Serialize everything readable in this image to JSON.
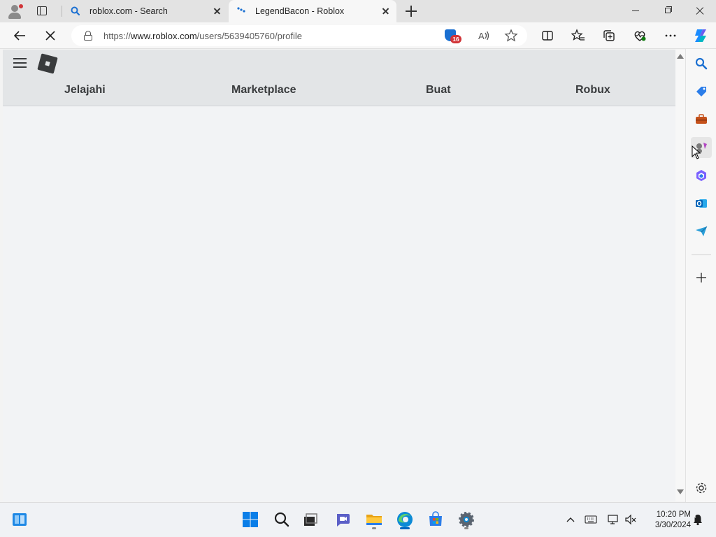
{
  "browser": {
    "tabs": [
      {
        "title": "roblox.com - Search",
        "active": false
      },
      {
        "title": "LegendBacon - Roblox",
        "active": true
      }
    ],
    "address": {
      "scheme": "https://",
      "host": "www.roblox.com",
      "path": "/users/5639405760/profile"
    },
    "extension_badge_count": "16"
  },
  "roblox": {
    "nav": [
      "Jelajahi",
      "Marketplace",
      "Buat",
      "Robux"
    ]
  },
  "taskbar": {
    "time": "10:20 PM",
    "date": "3/30/2024"
  },
  "colors": {
    "accent": "#0067c0",
    "roblox_header": "#e3e5e7",
    "roblox_text": "#393b3d"
  }
}
